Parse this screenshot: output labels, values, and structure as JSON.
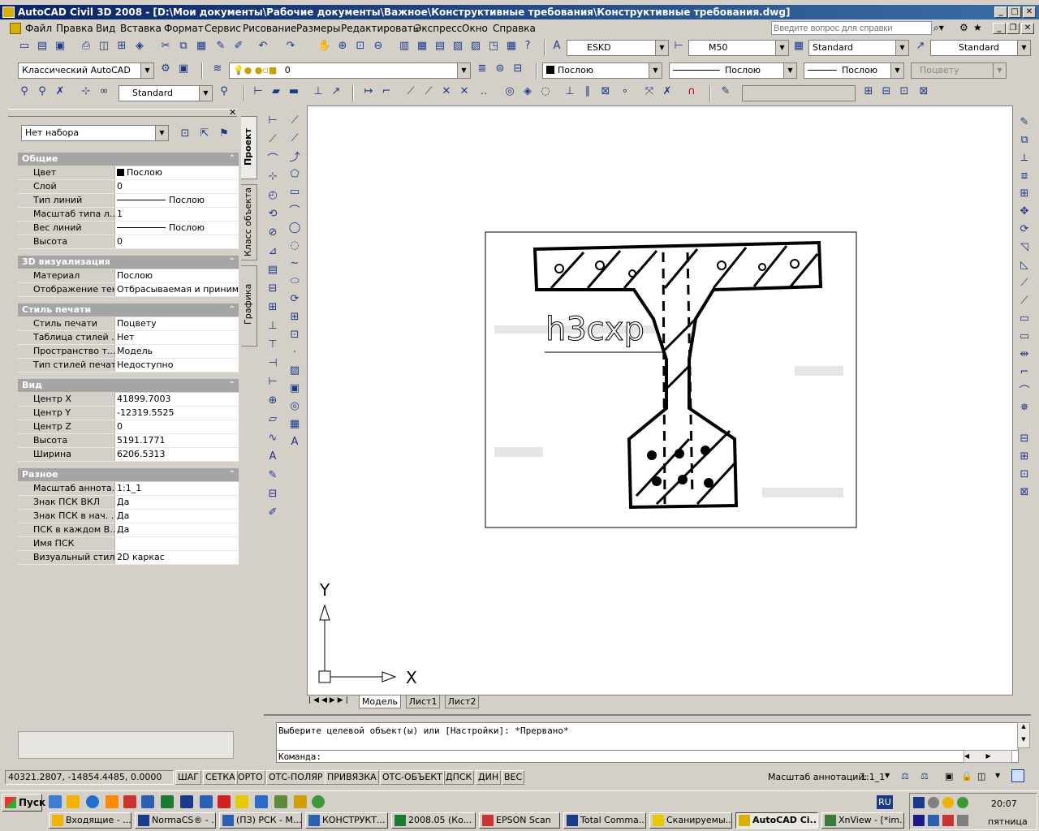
{
  "window": {
    "title": "AutoCAD Civil 3D 2008 - [D:\\Мои документы\\Рабочие документы\\Важное\\Конструктивные требования\\Конструктивные требования.dwg]"
  },
  "menu": {
    "items": [
      "Файл",
      "Правка",
      "Вид",
      "Вставка",
      "Формат",
      "Сервис",
      "Рисование",
      "Размеры",
      "Редактировать",
      "Экспресс",
      "Окно",
      "Справка"
    ],
    "help_placeholder": "Введите вопрос для справки"
  },
  "toolbar": {
    "text_style": "ESKD",
    "dim_style": "M50",
    "table_style": "Standard",
    "multileader_style": "Standard",
    "workspace": "Классический AutoCAD",
    "layer": "0",
    "color": "Послою",
    "linetype": "Послою",
    "lineweight": "Послою",
    "plotstyle": "Поцвету",
    "dim_combo": "Standard"
  },
  "properties": {
    "selection": "Нет набора",
    "sections": [
      {
        "title": "Общие",
        "rows": [
          {
            "key": "Цвет",
            "value": "Послою",
            "swatch": true
          },
          {
            "key": "Слой",
            "value": "0"
          },
          {
            "key": "Тип линий",
            "value": "Послою",
            "line": true
          },
          {
            "key": "Масштаб типа л...",
            "value": "1"
          },
          {
            "key": "Вес линий",
            "value": "Послою",
            "line": true
          },
          {
            "key": "Высота",
            "value": "0"
          }
        ]
      },
      {
        "title": "3D визуализация",
        "rows": [
          {
            "key": "Материал",
            "value": "Послою"
          },
          {
            "key": "Отображение тени",
            "value": "Отбрасываемая и приним..."
          }
        ]
      },
      {
        "title": "Стиль печати",
        "rows": [
          {
            "key": "Стиль печати",
            "value": "Поцвету"
          },
          {
            "key": "Таблица стилей ...",
            "value": "Нет"
          },
          {
            "key": "Пространство т...",
            "value": "Модель"
          },
          {
            "key": "Тип стилей печати",
            "value": "Недоступно"
          }
        ]
      },
      {
        "title": "Вид",
        "rows": [
          {
            "key": "Центр X",
            "value": "41899.7003"
          },
          {
            "key": "Центр Y",
            "value": "-12319.5525"
          },
          {
            "key": "Центр Z",
            "value": "0"
          },
          {
            "key": "Высота",
            "value": "5191.1771"
          },
          {
            "key": "Ширина",
            "value": "6206.5313"
          }
        ]
      },
      {
        "title": "Разное",
        "rows": [
          {
            "key": "Масштаб аннота...",
            "value": "1:1_1"
          },
          {
            "key": "Знак ПСК ВКЛ",
            "value": "Да"
          },
          {
            "key": "Знак ПСК в нач. ...",
            "value": "Да"
          },
          {
            "key": "ПСК в каждом В...",
            "value": "Да"
          },
          {
            "key": "Имя ПСК",
            "value": ""
          },
          {
            "key": "Визуальный стиль",
            "value": "2D каркас"
          }
        ]
      }
    ],
    "tabs": [
      "Проект",
      "Класс объекта",
      "Графика"
    ]
  },
  "drawing": {
    "annotation": "h3cxp",
    "axis_x": "X",
    "axis_y": "Y"
  },
  "layout_tabs": [
    "Модель",
    "Лист1",
    "Лист2"
  ],
  "command": {
    "history": "Выберите целевой объект(ы) или [Настройки]: *Прервано*",
    "prompt": "Команда:"
  },
  "status": {
    "coords": "40321.2807, -14854.4485, 0.0000",
    "buttons": [
      "ШАГ",
      "СЕТКА",
      "ОРТО",
      "ОТС-ПОЛЯР",
      "ПРИВЯЗКА",
      "ОТС-ОБЪЕКТ",
      "ДПСК",
      "ДИН",
      "ВЕС"
    ],
    "anno_scale_label": "Масштаб аннотаций:",
    "anno_scale_value": "1:1_1"
  },
  "taskbar": {
    "start": "Пуск",
    "lang": "RU",
    "clock": "20:07",
    "day": "пятница",
    "tasks": [
      "Входящие - ...",
      "NormaCS® - ...",
      "(ПЗ) РСК - М...",
      "КОНСТРУКТ...",
      "2008.05 (Ко...",
      "EPSON Scan",
      "Total Comma...",
      "Сканируемы...",
      "AutoCAD Ci...",
      "XnView - [*im..."
    ]
  },
  "colors": {
    "titlebar": "#0a246a",
    "face": "#d4d0c8",
    "canvas": "#ffffff"
  }
}
